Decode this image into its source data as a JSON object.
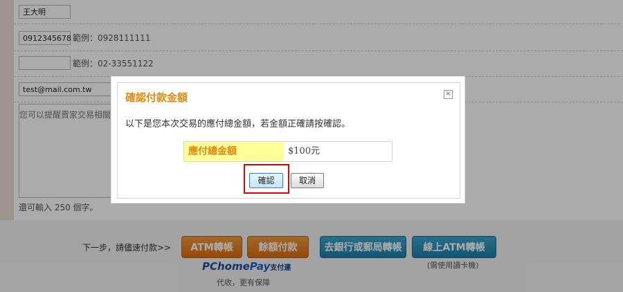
{
  "form": {
    "name_value": "王大明",
    "mobile_value": "0912345678",
    "mobile_hint": "範例：0928111111",
    "phone_value": "",
    "phone_hint": "範例：02-33551122",
    "email_value": "test@mail.com.tw",
    "note_placeholder": "您可以提醒賣家交易相關",
    "remaining": "還可輸入 250 個字。"
  },
  "footer": {
    "next_label": "下一步，請儘速付款>>",
    "buttons": [
      "ATM轉帳",
      "餘額付款",
      "去銀行或郵局轉帳",
      "線上ATM轉帳"
    ],
    "pchome_brand": "PChome",
    "pchome_pay": "Pay",
    "pchome_small": "支付連",
    "daishou_note": "代收，更有保障",
    "reader_note": "(需使用讀卡機)"
  },
  "modal": {
    "title": "確認付款金額",
    "close_glyph": "×",
    "message": "以下是您本次交易的應付總金額，若金額正確請按確認。",
    "amount_label": "應付總金額",
    "amount_value": "$100元",
    "confirm_label": "確認",
    "cancel_label": "取消"
  },
  "colors": {
    "accent_orange": "#e08a12",
    "button_orange": "#dc6f10",
    "button_blue": "#1f7fa9",
    "highlight_red": "#e60000",
    "amount_bg": "#ffff99"
  }
}
